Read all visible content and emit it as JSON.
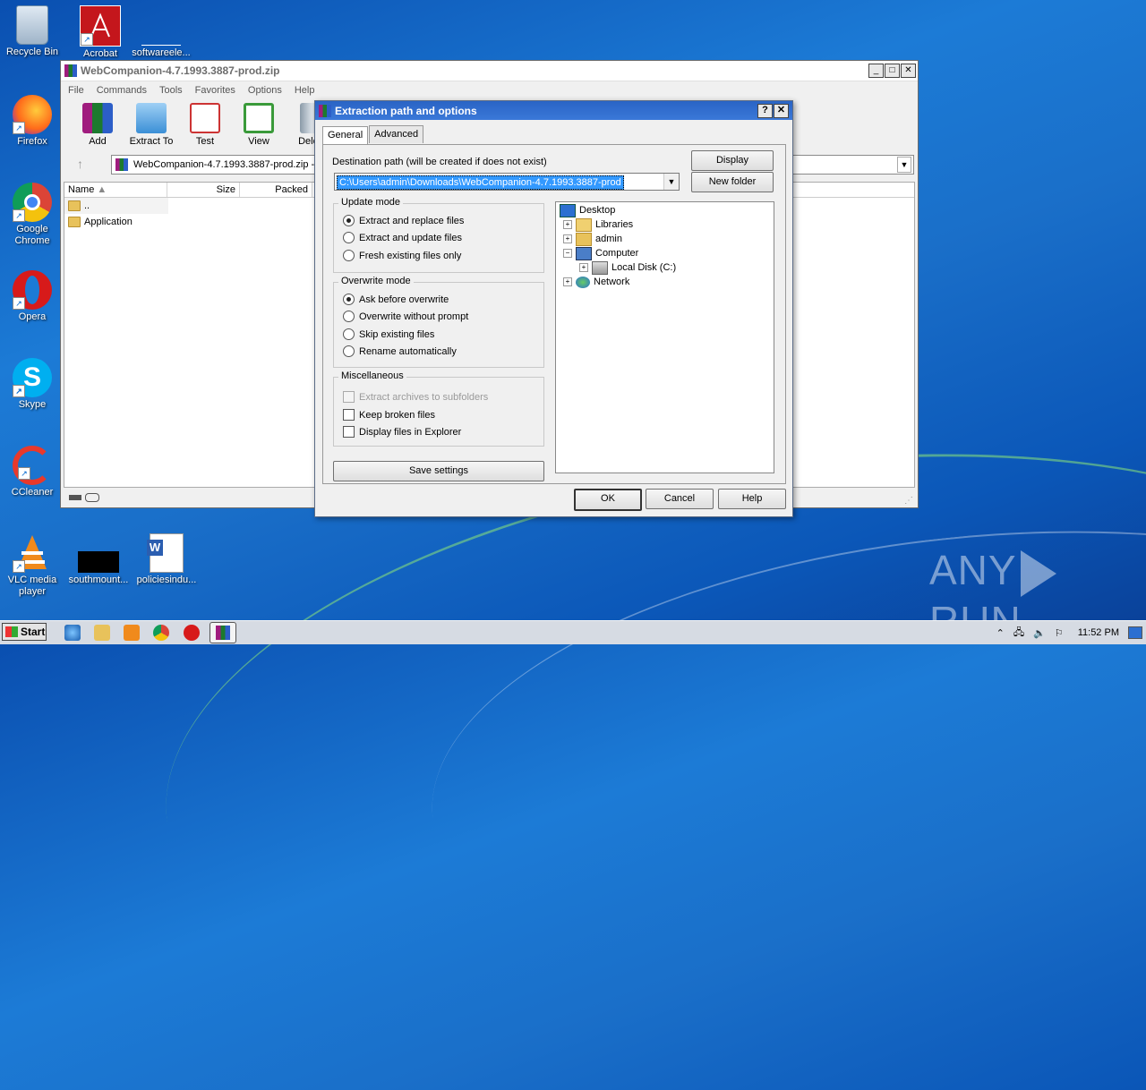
{
  "desktop": {
    "icons": [
      {
        "label": "Recycle Bin"
      },
      {
        "label": "Acrobat"
      },
      {
        "label": "softwareele..."
      },
      {
        "label": "Firefox"
      },
      {
        "label": "Google Chrome"
      },
      {
        "label": "Opera"
      },
      {
        "label": "Skype"
      },
      {
        "label": "CCleaner"
      },
      {
        "label": "VLC media player"
      },
      {
        "label": "southmount..."
      },
      {
        "label": "policiesindu..."
      }
    ],
    "watermark": "ANY RUN"
  },
  "winrar": {
    "title": "WebCompanion-4.7.1993.3887-prod.zip",
    "menu": [
      "File",
      "Commands",
      "Tools",
      "Favorites",
      "Options",
      "Help"
    ],
    "toolbar": [
      "Add",
      "Extract To",
      "Test",
      "View",
      "Delete"
    ],
    "address": "WebCompanion-4.7.1993.3887-prod.zip -",
    "columns": [
      "Name",
      "Size",
      "Packed"
    ],
    "files": [
      {
        "name": ".."
      },
      {
        "name": "Application"
      }
    ]
  },
  "dialog": {
    "title": "Extraction path and options",
    "help_btn": "?",
    "close_btn": "✕",
    "tabs": [
      "General",
      "Advanced"
    ],
    "dest_label": "Destination path (will be created if does not exist)",
    "dest_value": "C:\\Users\\admin\\Downloads\\WebCompanion-4.7.1993.3887-prod",
    "display_btn": "Display",
    "new_folder_btn": "New folder",
    "update_mode": {
      "label": "Update mode",
      "options": [
        "Extract and replace files",
        "Extract and update files",
        "Fresh existing files only"
      ]
    },
    "overwrite_mode": {
      "label": "Overwrite mode",
      "options": [
        "Ask before overwrite",
        "Overwrite without prompt",
        "Skip existing files",
        "Rename automatically"
      ]
    },
    "misc": {
      "label": "Miscellaneous",
      "options": [
        "Extract archives to subfolders",
        "Keep broken files",
        "Display files in Explorer"
      ]
    },
    "save_settings": "Save settings",
    "tree": [
      "Desktop",
      "Libraries",
      "admin",
      "Computer",
      "Local Disk (C:)",
      "Network"
    ],
    "ok": "OK",
    "cancel": "Cancel",
    "help": "Help"
  },
  "taskbar": {
    "start": "Start",
    "time": "11:52 PM"
  }
}
